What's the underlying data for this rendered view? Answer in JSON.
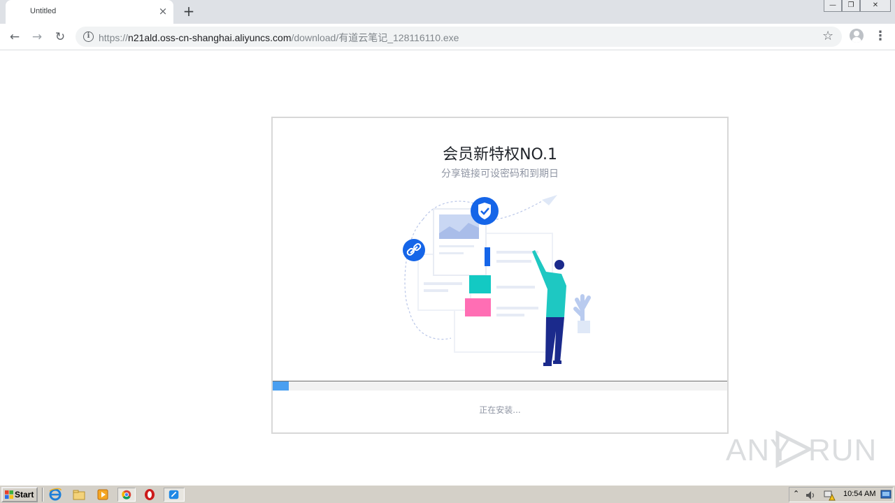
{
  "browser": {
    "tab_title": "Untitled",
    "tab_close_glyph": "×",
    "newtab_glyph": "+",
    "window_controls": {
      "minimize": "—",
      "restore": "❐",
      "close": "✕"
    },
    "nav": {
      "back": "←",
      "forward": "→",
      "reload": "↻"
    },
    "url": {
      "scheme": "https://",
      "host": "n21ald.oss-cn-shanghai.aliyuncs.com",
      "path": "/download/有道云笔记_128116110.exe"
    },
    "star_glyph": "☆",
    "menu_glyph": "⋮"
  },
  "installer": {
    "title": "会员新特权NO.1",
    "subtitle": "分享链接可设密码和到期日",
    "progress_fraction": 0.035,
    "status": "正在安装..."
  },
  "watermark": {
    "left": "ANY",
    "right": "RUN"
  },
  "taskbar": {
    "start_label": "Start",
    "clock": "10:54 AM",
    "icons": [
      "ie-icon",
      "explorer-icon",
      "media-player-icon",
      "chrome-icon",
      "opera-icon",
      "installer-app-icon"
    ]
  },
  "colors": {
    "accent_blue": "#4a9ff0",
    "link_badge_blue": "#1565e8",
    "teal": "#13c9c3",
    "pink": "#ff6eb4",
    "figure_shirt": "#1ec8c2",
    "figure_pants": "#1b2a8c"
  }
}
